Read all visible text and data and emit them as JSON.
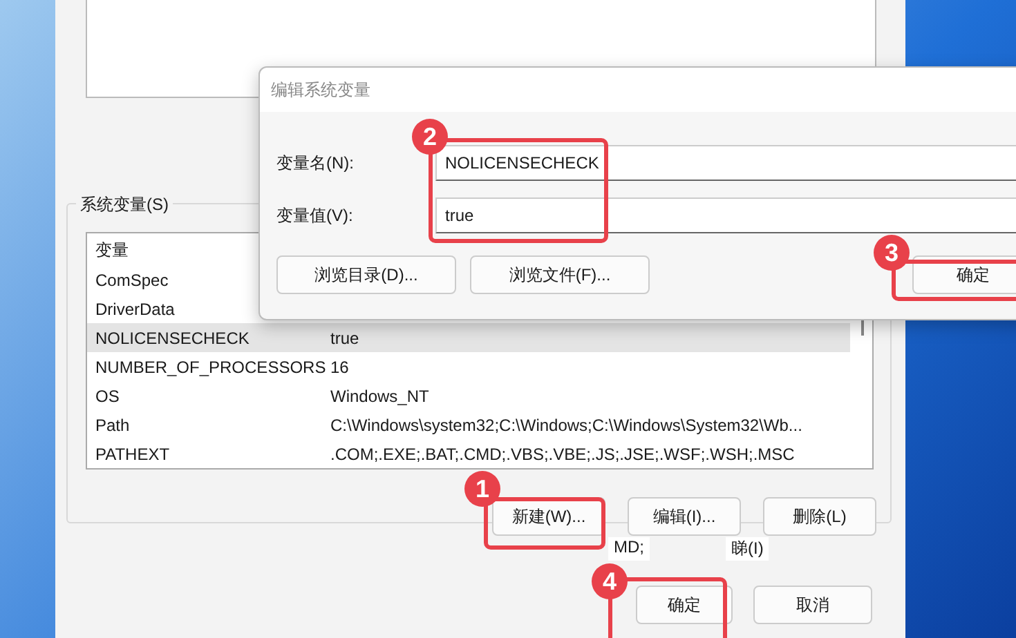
{
  "system_variables": {
    "label": "系统变量(S)",
    "header": "变量",
    "rows": [
      {
        "name": "ComSpec",
        "value": "",
        "selected": false
      },
      {
        "name": "DriverData",
        "value": "",
        "selected": false
      },
      {
        "name": "NOLICENSECHECK",
        "value": "true",
        "selected": true
      },
      {
        "name": "NUMBER_OF_PROCESSORS",
        "value": "16",
        "selected": false
      },
      {
        "name": "OS",
        "value": "Windows_NT",
        "selected": false
      },
      {
        "name": "Path",
        "value": "C:\\Windows\\system32;C:\\Windows;C:\\Windows\\System32\\Wb...",
        "selected": false
      },
      {
        "name": "PATHEXT",
        "value": ".COM;.EXE;.BAT;.CMD;.VBS;.VBE;.JS;.JSE;.WSF;.WSH;.MSC",
        "selected": false
      }
    ],
    "buttons": [
      "新建(W)...",
      "编辑(I)...",
      "删除(L)"
    ]
  },
  "fragments": [
    "MD;",
    "睇(I)"
  ],
  "bottom_buttons": [
    "确定",
    "取消"
  ],
  "dialog": {
    "title": "编辑系统变量",
    "fields": [
      {
        "label": "变量名(N):",
        "value": "NOLICENSECHECK"
      },
      {
        "label": "变量值(V):",
        "value": "true"
      }
    ],
    "browse_buttons": [
      "浏览目录(D)...",
      "浏览文件(F)..."
    ],
    "ok_button": "确定"
  },
  "callouts": [
    {
      "number": "1"
    },
    {
      "number": "2"
    },
    {
      "number": "3"
    },
    {
      "number": "4"
    }
  ]
}
